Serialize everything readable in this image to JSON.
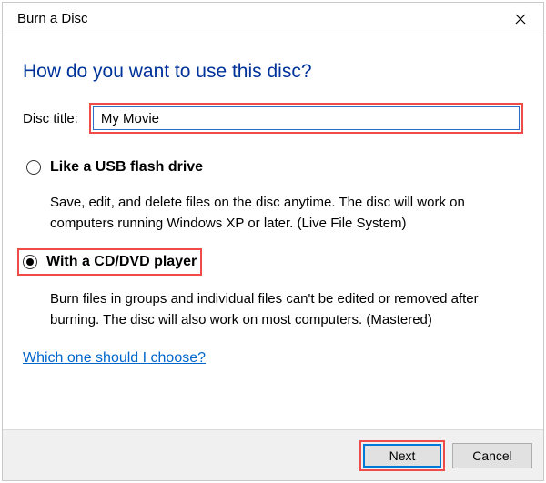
{
  "window": {
    "title": "Burn a Disc"
  },
  "heading": "How do you want to use this disc?",
  "disc": {
    "title_label": "Disc title:",
    "title_value": "My Movie"
  },
  "options": {
    "usb": {
      "label": "Like a USB flash drive",
      "desc": "Save, edit, and delete files on the disc anytime. The disc will work on computers running Windows XP or later. (Live File System)"
    },
    "cd": {
      "label": "With a CD/DVD player",
      "desc": "Burn files in groups and individual files can't be edited or removed after burning. The disc will also work on most computers. (Mastered)"
    }
  },
  "help_link": "Which one should I choose?",
  "buttons": {
    "next": "Next",
    "cancel": "Cancel"
  }
}
